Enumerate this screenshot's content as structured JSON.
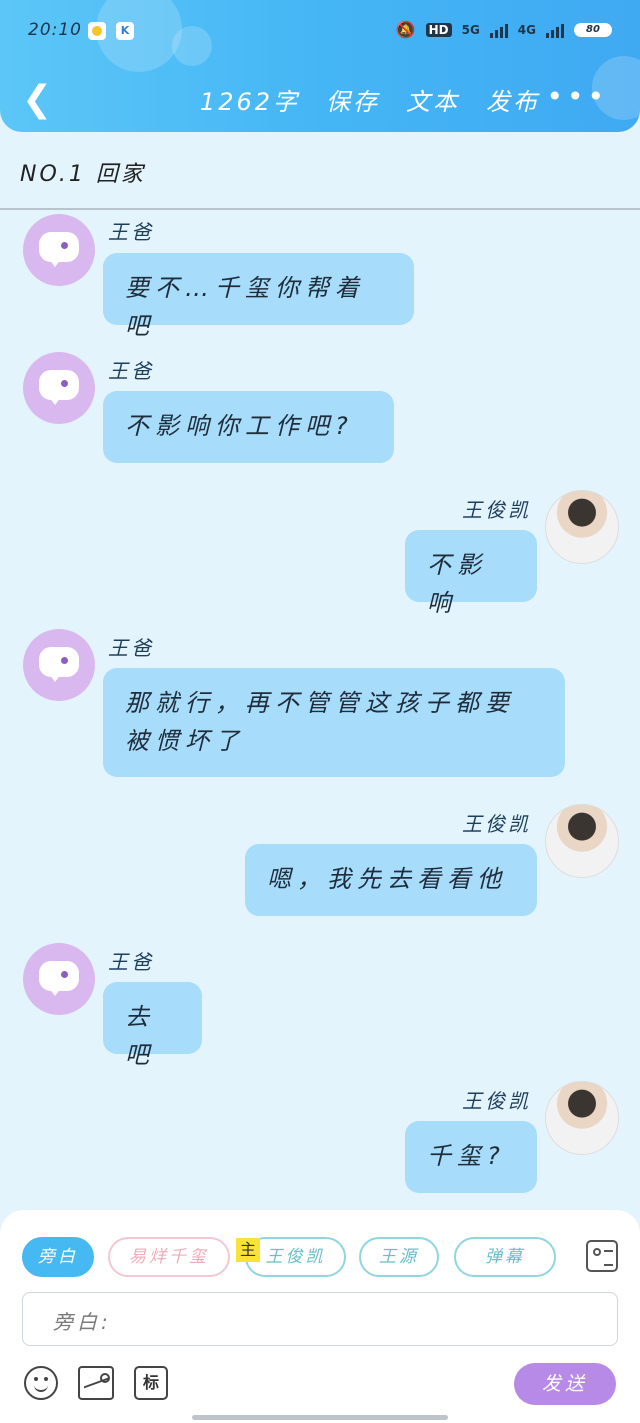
{
  "status_bar": {
    "time": "20:10",
    "app2_letter": "K",
    "net_hd": "HD",
    "net_5g": "5G",
    "net_4g": "4G",
    "battery": "80"
  },
  "header": {
    "word_count": "1262字",
    "save": "保存",
    "text": "文本",
    "publish": "发布",
    "more": "•••"
  },
  "chapter_title": "NO.1 回家",
  "messages": [
    {
      "side": "left",
      "name": "王爸",
      "text": "要不…千玺你帮着吧"
    },
    {
      "side": "left",
      "name": "王爸",
      "text": "不影响你工作吧?"
    },
    {
      "side": "right",
      "name": "王俊凯",
      "text": "不影响"
    },
    {
      "side": "left",
      "name": "王爸",
      "text": "那就行，再不管管这孩子都要被惯坏了"
    },
    {
      "side": "right",
      "name": "王俊凯",
      "text": "嗯，我先去看看他"
    },
    {
      "side": "left",
      "name": "王爸",
      "text": "去吧"
    },
    {
      "side": "right",
      "name": "王俊凯",
      "text": "千玺?"
    }
  ],
  "roles": {
    "narration": "旁白",
    "yi_yang": "易烊千玺",
    "main_tag": "主",
    "wang_junkai": "王俊凯",
    "wang_yuan": "王源",
    "curtain": "弹幕"
  },
  "input": {
    "placeholder": "旁白:"
  },
  "toolbar": {
    "mark_label": "标",
    "send_label": "发送"
  },
  "colors": {
    "header": "#45b6f5",
    "bubble": "#a7dcfb",
    "send": "#b68ae6",
    "background": "#e3f4fd"
  }
}
